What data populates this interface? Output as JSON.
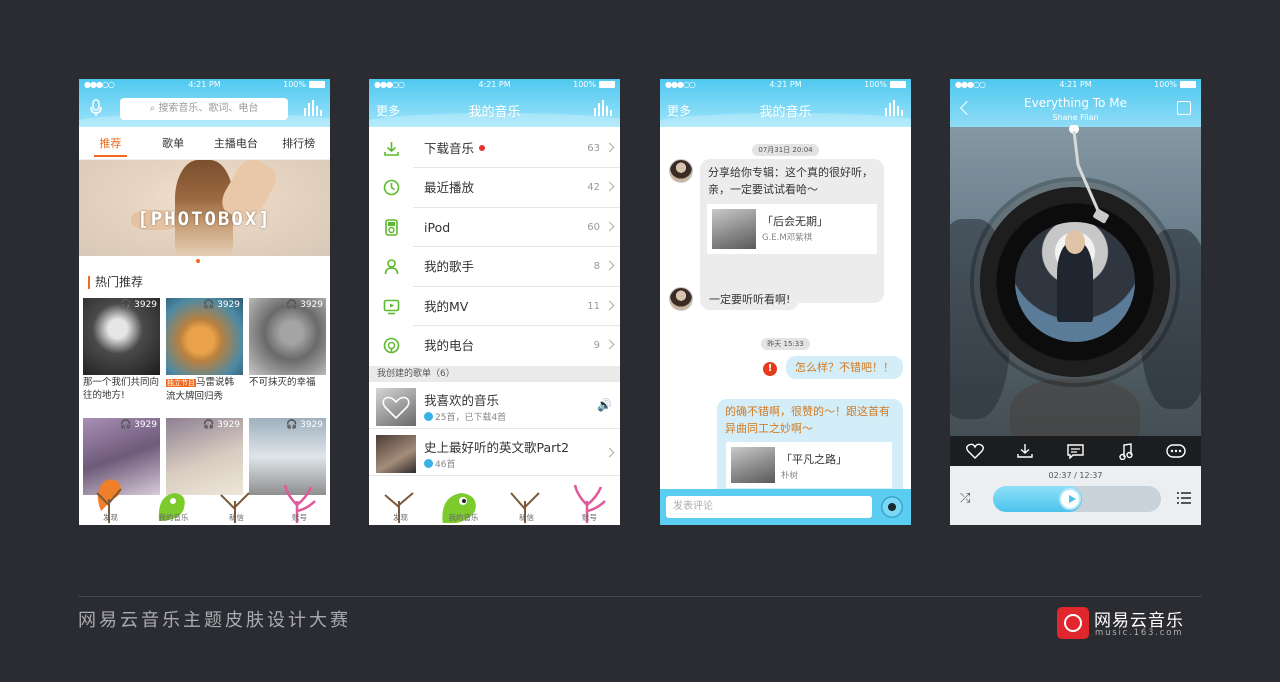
{
  "status": {
    "signal": "●●●○○",
    "time": "4:21 PM",
    "battery": "100%"
  },
  "screen1": {
    "search_placeholder": "搜索音乐、歌词、电台",
    "tabs": [
      "推荐",
      "歌单",
      "主播电台",
      "排行榜"
    ],
    "banner_text": "[PHOTOBOX]",
    "section_title": "热门推荐",
    "items": [
      {
        "count": "3929",
        "caption": "那一个我们共同向往的地方!"
      },
      {
        "count": "3929",
        "tag": "独立节目",
        "caption": "马雷说韩流大牌回归秀"
      },
      {
        "count": "3929",
        "caption": "不可抹灭的幸福"
      },
      {
        "count": "3929",
        "caption": ""
      },
      {
        "count": "3929",
        "caption": ""
      },
      {
        "count": "3929",
        "caption": ""
      }
    ]
  },
  "tabbar": [
    "发现",
    "我的音乐",
    "私信",
    "账号"
  ],
  "screen2": {
    "left": "更多",
    "title": "我的音乐",
    "rows": [
      {
        "label": "下载音乐",
        "count": "63",
        "icon": "download-icon"
      },
      {
        "label": "最近播放",
        "count": "42",
        "icon": "clock-icon"
      },
      {
        "label": "iPod",
        "count": "60",
        "icon": "ipod-icon"
      },
      {
        "label": "我的歌手",
        "count": "8",
        "icon": "singer-icon"
      },
      {
        "label": "我的MV",
        "count": "11",
        "icon": "mv-icon"
      },
      {
        "label": "我的电台",
        "count": "9",
        "icon": "radio-icon"
      }
    ],
    "created_header": "我创建的歌单（6）",
    "playlists": [
      {
        "title": "我喜欢的音乐",
        "sub": "25首，已下载4首"
      },
      {
        "title": "史上最好听的英文歌Part2",
        "sub": "46首"
      }
    ]
  },
  "screen3": {
    "left": "更多",
    "title": "我的音乐",
    "ts1": "07月31日 20:04",
    "msg1": "分享给你专辑：这个真的很好听，亲，一定要试试看哈～",
    "card1": {
      "title": "「后会无期」",
      "artist": "G.E.M邓紫棋"
    },
    "msg2": "一定要听听看啊!",
    "ts2": "昨天 15:33",
    "msg3": "怎么样？不错吧！！",
    "msg4": "的确不错啊，很赞的～！跟这首有异曲同工之妙啊～",
    "card2": {
      "title": "「平凡之路」",
      "artist": "朴树"
    },
    "input_placeholder": "发表评论"
  },
  "screen4": {
    "song": "Everything To Me",
    "artist": "Shane Filan",
    "time": "02:37 / 12:37",
    "progress": 0.46
  },
  "footer": {
    "title": "网易云音乐主题皮肤设计大赛",
    "brand": "网易云音乐",
    "url": "music.163.com"
  },
  "colors": {
    "accent": "#f06a1f",
    "header": "#4fc8ef",
    "brand": "#e0272e"
  }
}
